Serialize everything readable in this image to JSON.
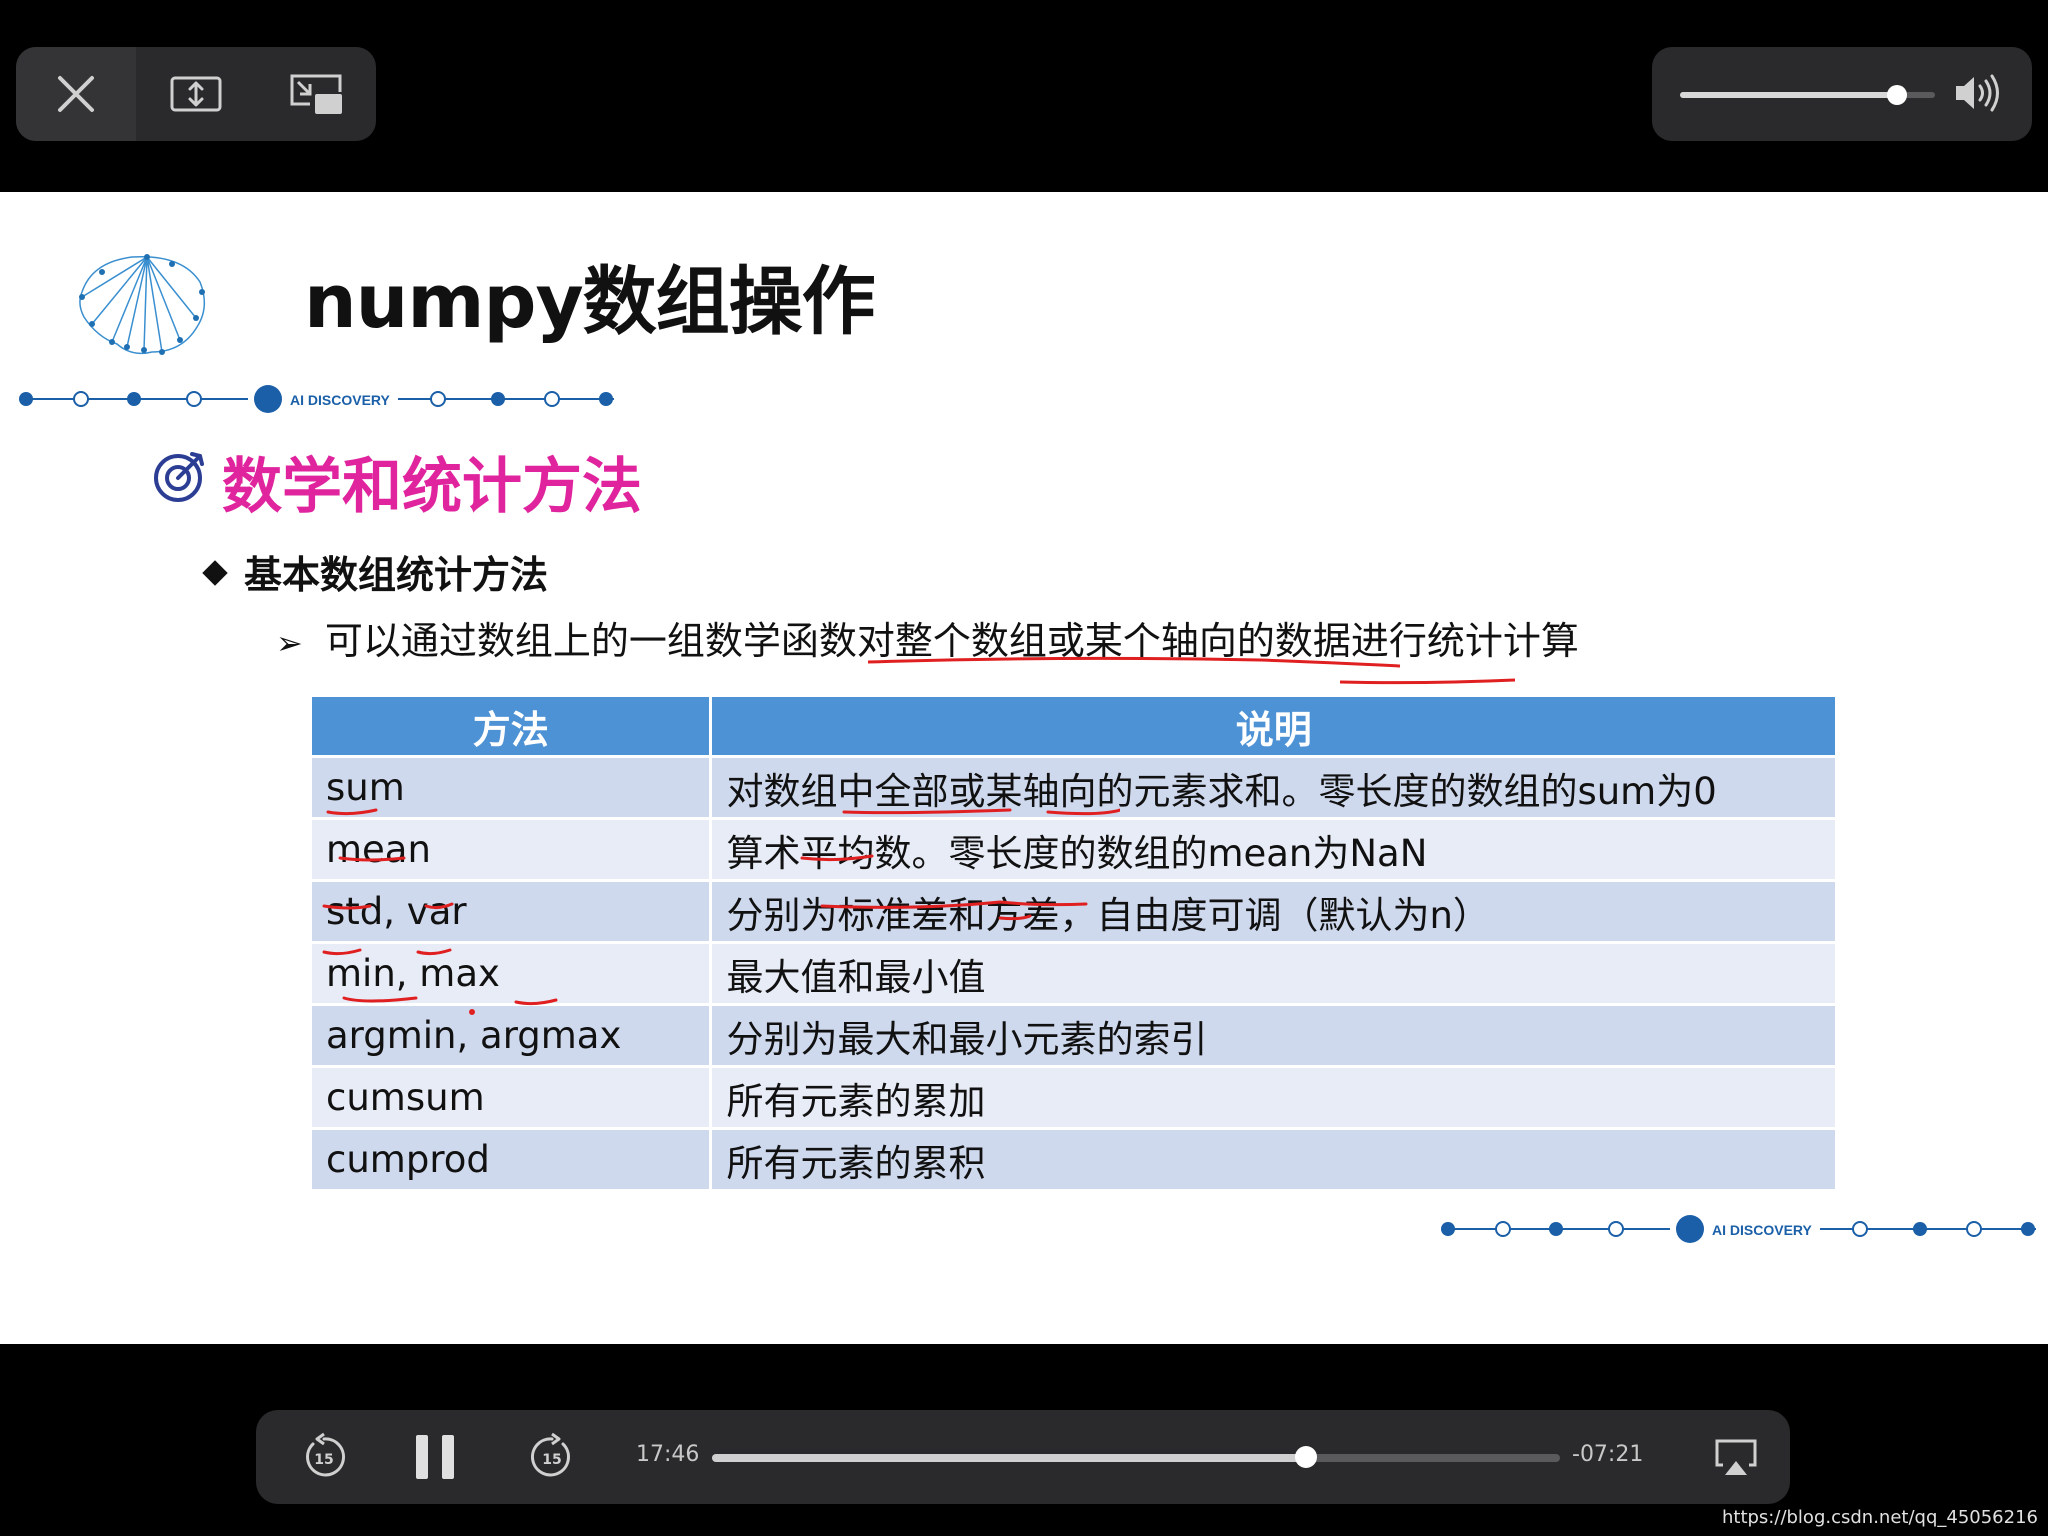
{
  "player": {
    "buttons": {
      "close": "close-icon",
      "resize": "resize-icon",
      "pip": "picture-in-picture-icon",
      "skip_back": "skip-back-15-icon",
      "pause": "pause-icon",
      "skip_forward": "skip-forward-15-icon",
      "airplay": "airplay-icon",
      "volume": "speaker-volume-icon"
    },
    "skip_seconds": "15",
    "time_elapsed": "17:46",
    "time_remaining": "-07:21",
    "progress_fraction": 0.7,
    "volume_fraction": 0.85
  },
  "slide": {
    "title": "numpy数组操作",
    "brand": "AI DISCOVERY",
    "section_title": "数学和统计方法",
    "bullet1": "基本数组统计方法",
    "bullet2": "可以通过数组上的一组数学函数对整个数组或某个轴向的数据进行统计计算",
    "table": {
      "headers": [
        "方法",
        "说明"
      ],
      "rows": [
        [
          "sum",
          "对数组中全部或某轴向的元素求和。零长度的数组的sum为0"
        ],
        [
          "mean",
          "算术平均数。零长度的数组的mean为NaN"
        ],
        [
          "std, var",
          "分别为标准差和方差，自由度可调（默认为n）"
        ],
        [
          "min, max",
          "最大值和最小值"
        ],
        [
          "argmin, argmax",
          "分别为最大和最小元素的索引"
        ],
        [
          "cumsum",
          "所有元素的累加"
        ],
        [
          "cumprod",
          "所有元素的累积"
        ]
      ]
    }
  },
  "watermark": "https://blog.csdn.net/qq_45056216",
  "colors": {
    "section_title": "#e0249e",
    "table_header": "#4e92d6",
    "row_odd": "#cfd9ee",
    "row_even": "#e8ecf6",
    "annotation_red": "#e02020",
    "deco_blue": "#1a5fa8"
  }
}
